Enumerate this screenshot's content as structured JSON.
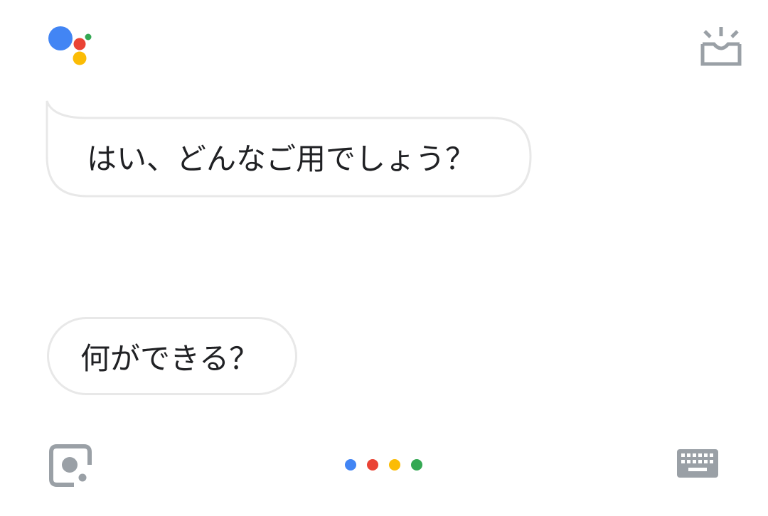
{
  "colors": {
    "blue": "#4285F4",
    "red": "#EA4335",
    "yellow": "#FBBC05",
    "green": "#34A853",
    "icon_gray": "#9AA0A6",
    "bubble_border": "#E8E8E8",
    "text": "#202124"
  },
  "header": {
    "logo_icon": "google-assistant-logo",
    "snapshot_icon": "snapshot-tray-icon"
  },
  "conversation": {
    "assistant_message": "はい、どんなご用でしょう？",
    "user_suggestion": "何ができる？"
  },
  "footer": {
    "lens_icon": "lens-icon",
    "mic_indicator_icon": "four-color-dots-icon",
    "keyboard_icon": "keyboard-icon"
  }
}
